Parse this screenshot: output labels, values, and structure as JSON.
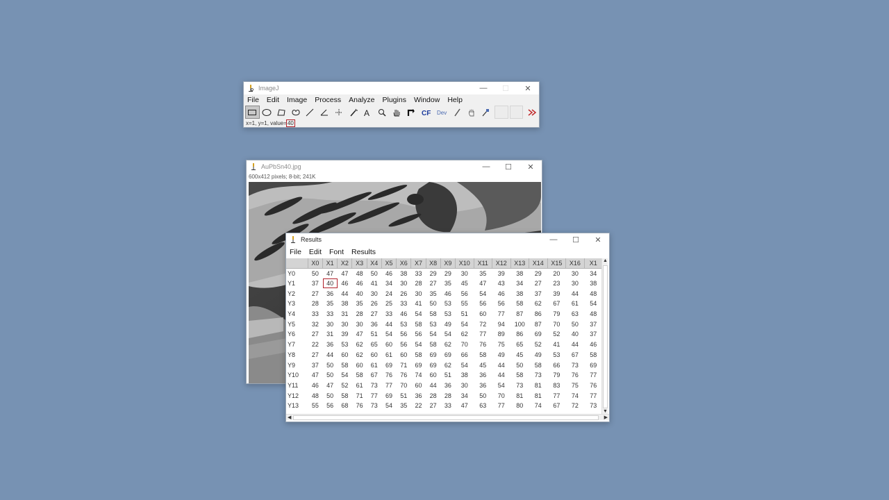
{
  "imagej": {
    "title": "ImageJ",
    "menu": [
      "File",
      "Edit",
      "Image",
      "Process",
      "Analyze",
      "Plugins",
      "Window",
      "Help"
    ],
    "status_prefix": "x=1, y=1, value=",
    "status_value": "40"
  },
  "image_window": {
    "title": "AuPbSn40.jpg",
    "info": "600x412 pixels; 8-bit; 241K"
  },
  "results": {
    "title": "Results",
    "menu": [
      "File",
      "Edit",
      "Font",
      "Results"
    ],
    "columns": [
      "X0",
      "X1",
      "X2",
      "X3",
      "X4",
      "X5",
      "X6",
      "X7",
      "X8",
      "X9",
      "X10",
      "X11",
      "X12",
      "X13",
      "X14",
      "X15",
      "X16",
      "X1"
    ],
    "rows": [
      {
        "label": "Y0",
        "values": [
          "50",
          "47",
          "47",
          "48",
          "50",
          "46",
          "38",
          "33",
          "29",
          "29",
          "30",
          "35",
          "39",
          "38",
          "29",
          "20",
          "30",
          "34"
        ]
      },
      {
        "label": "Y1",
        "values": [
          "37",
          "40",
          "46",
          "46",
          "41",
          "34",
          "30",
          "28",
          "27",
          "35",
          "45",
          "47",
          "43",
          "34",
          "27",
          "23",
          "30",
          "38"
        ]
      },
      {
        "label": "Y2",
        "values": [
          "27",
          "36",
          "44",
          "40",
          "30",
          "24",
          "26",
          "30",
          "35",
          "46",
          "56",
          "54",
          "46",
          "38",
          "37",
          "39",
          "44",
          "48"
        ]
      },
      {
        "label": "Y3",
        "values": [
          "28",
          "35",
          "38",
          "35",
          "26",
          "25",
          "33",
          "41",
          "50",
          "53",
          "55",
          "56",
          "56",
          "58",
          "62",
          "67",
          "61",
          "54"
        ]
      },
      {
        "label": "Y4",
        "values": [
          "33",
          "33",
          "31",
          "28",
          "27",
          "33",
          "46",
          "54",
          "58",
          "53",
          "51",
          "60",
          "77",
          "87",
          "86",
          "79",
          "63",
          "48"
        ]
      },
      {
        "label": "Y5",
        "values": [
          "32",
          "30",
          "30",
          "30",
          "36",
          "44",
          "53",
          "58",
          "53",
          "49",
          "54",
          "72",
          "94",
          "100",
          "87",
          "70",
          "50",
          "37"
        ]
      },
      {
        "label": "Y6",
        "values": [
          "27",
          "31",
          "39",
          "47",
          "51",
          "54",
          "56",
          "56",
          "54",
          "54",
          "62",
          "77",
          "89",
          "86",
          "69",
          "52",
          "40",
          "37"
        ]
      },
      {
        "label": "Y7",
        "values": [
          "22",
          "36",
          "53",
          "62",
          "65",
          "60",
          "56",
          "54",
          "58",
          "62",
          "70",
          "76",
          "75",
          "65",
          "52",
          "41",
          "44",
          "46"
        ]
      },
      {
        "label": "Y8",
        "values": [
          "27",
          "44",
          "60",
          "62",
          "60",
          "61",
          "60",
          "58",
          "69",
          "69",
          "66",
          "58",
          "49",
          "45",
          "49",
          "53",
          "67",
          "58"
        ]
      },
      {
        "label": "Y9",
        "values": [
          "37",
          "50",
          "58",
          "60",
          "61",
          "69",
          "71",
          "69",
          "69",
          "62",
          "54",
          "45",
          "44",
          "50",
          "58",
          "66",
          "73",
          "69"
        ]
      },
      {
        "label": "Y10",
        "values": [
          "47",
          "50",
          "54",
          "58",
          "67",
          "76",
          "76",
          "74",
          "60",
          "51",
          "38",
          "36",
          "44",
          "58",
          "73",
          "79",
          "76",
          "77"
        ]
      },
      {
        "label": "Y11",
        "values": [
          "46",
          "47",
          "52",
          "61",
          "73",
          "77",
          "70",
          "60",
          "44",
          "36",
          "30",
          "36",
          "54",
          "73",
          "81",
          "83",
          "75",
          "76"
        ]
      },
      {
        "label": "Y12",
        "values": [
          "48",
          "50",
          "58",
          "71",
          "77",
          "69",
          "51",
          "36",
          "28",
          "28",
          "34",
          "50",
          "70",
          "81",
          "81",
          "77",
          "74",
          "77"
        ]
      },
      {
        "label": "Y13",
        "values": [
          "55",
          "56",
          "68",
          "76",
          "73",
          "54",
          "35",
          "22",
          "27",
          "33",
          "47",
          "63",
          "77",
          "80",
          "74",
          "67",
          "72",
          "73"
        ]
      }
    ],
    "selected": {
      "row": 1,
      "col": 1
    }
  },
  "icons": {
    "tools": [
      "rectangle-icon",
      "oval-icon",
      "polygon-icon",
      "freehand-icon",
      "line-icon",
      "angle-icon",
      "point-icon",
      "wand-icon",
      "text-icon",
      "magnifier-icon",
      "hand-icon",
      "dropper-icon",
      "cf-icon",
      "dev-icon",
      "brush-icon",
      "hand-tool-icon",
      "pipette-icon",
      "blank-tool",
      "blank-tool",
      "more-tools-icon"
    ]
  },
  "colors": {
    "desktop": "#7792b3",
    "highlight": "#b0202a",
    "more_arrow": "#c0282a",
    "cf_text": "#1a3a9c"
  }
}
